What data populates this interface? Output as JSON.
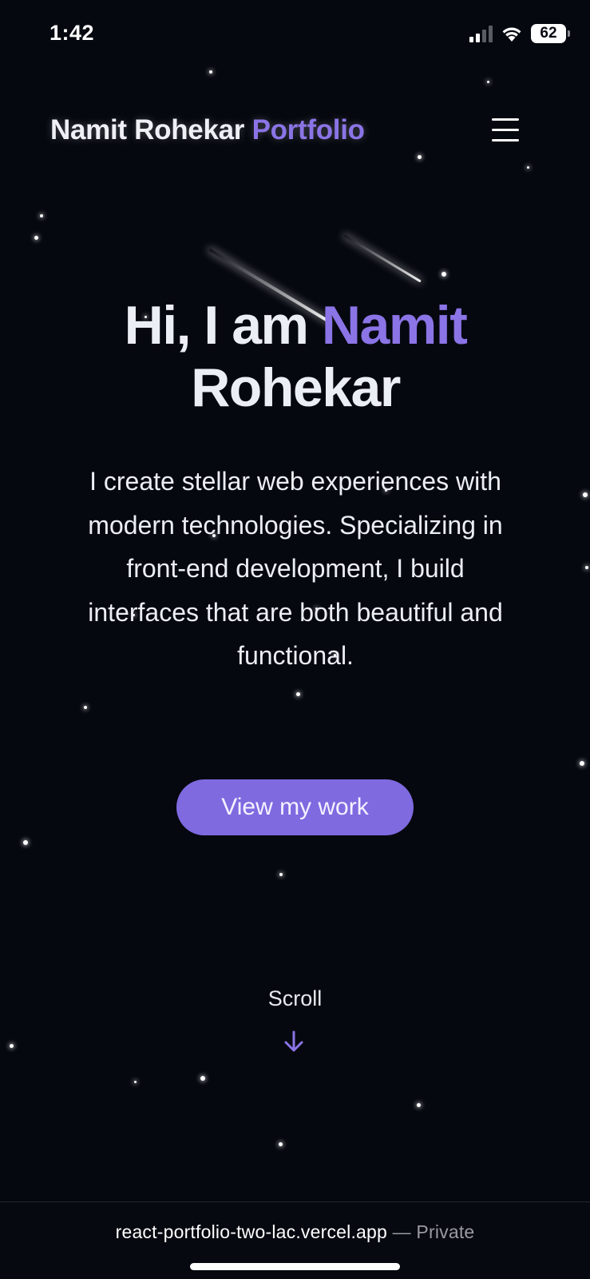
{
  "status_bar": {
    "time": "1:42",
    "battery": "62",
    "signal_icon": "cellular-signal-icon",
    "wifi_icon": "wifi-icon",
    "battery_icon": "battery-icon"
  },
  "header": {
    "brand_name": "Namit Rohekar",
    "brand_accent": "Portfolio",
    "menu_icon": "hamburger-menu-icon"
  },
  "hero": {
    "greeting": "Hi, I am",
    "first_name": "Namit",
    "last_name": "Rohekar",
    "description": "I create stellar web experiences with modern technologies. Specializing in front-end development, I build interfaces that are both beautiful and functional.",
    "cta_label": "View my work"
  },
  "scroll": {
    "label": "Scroll",
    "icon": "arrow-down-icon"
  },
  "browser": {
    "url": "react-portfolio-two-lac.vercel.app",
    "separator": " — ",
    "privacy": "Private"
  },
  "colors": {
    "background": "#060810",
    "accent": "#8b74e6",
    "button": "#7f6ae0",
    "text": "#eceef5"
  }
}
